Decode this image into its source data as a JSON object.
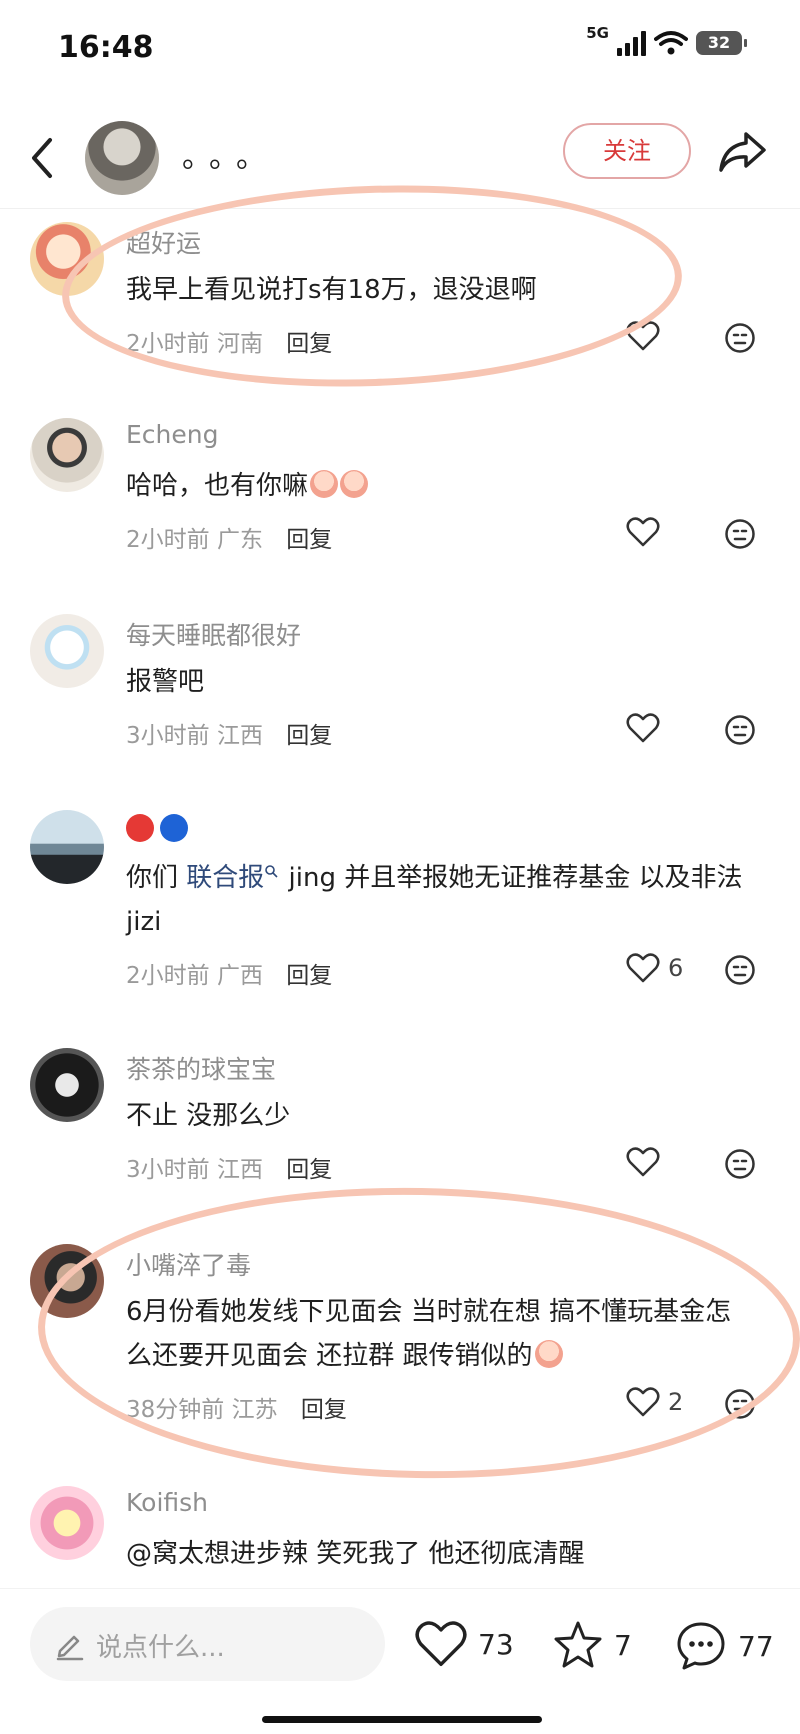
{
  "status_bar": {
    "time": "16:48",
    "network": "5G",
    "battery": "32"
  },
  "header": {
    "author_name": "。。。",
    "follow_label": "关注"
  },
  "comments": [
    {
      "name": "超好运",
      "text": "我早上看见说打s有18万，退没退啊",
      "time": "2小时前",
      "location": "河南",
      "reply": "回复",
      "likes": ""
    },
    {
      "name": "Echeng",
      "text": "哈哈，也有你嘛",
      "time": "2小时前",
      "location": "广东",
      "reply": "回复",
      "likes": ""
    },
    {
      "name": "每天睡眠都很好",
      "text": "报警吧",
      "time": "3小时前",
      "location": "江西",
      "reply": "回复",
      "likes": ""
    },
    {
      "name": "",
      "text_prefix": "你们 ",
      "text_link": "联合报",
      "text_rest": " jing 并且举报她无证推荐基金 以及非法jizi",
      "time": "2小时前",
      "location": "广西",
      "reply": "回复",
      "likes": "6"
    },
    {
      "name": "茶茶的球宝宝",
      "text": "不止 没那么少",
      "time": "3小时前",
      "location": "江西",
      "reply": "回复",
      "likes": ""
    },
    {
      "name": "小嘴淬了毒",
      "text": "6月份看她发线下见面会 当时就在想 搞不懂玩基金怎么还要开见面会 还拉群 跟传销似的",
      "time": "38分钟前",
      "location": "江苏",
      "reply": "回复",
      "likes": "2"
    },
    {
      "name": "Koifish",
      "text": "@窝太想进步辣  笑死我了 他还彻底清醒",
      "time": "",
      "location": "",
      "reply": "",
      "likes": ""
    }
  ],
  "bottom_bar": {
    "placeholder": "说点什么...",
    "likes": "73",
    "stars": "7",
    "comments": "77"
  },
  "colors": {
    "follow_red": "#d83a3a",
    "highlight_oval": "#f7c5b3",
    "link_blue": "#2f4a7a",
    "dot_red": "#e53935",
    "dot_blue": "#1e63d6"
  },
  "icons": [
    "back-arrow-icon",
    "share-icon",
    "heart-icon",
    "dislike-face-icon",
    "pencil-icon",
    "star-icon",
    "chat-bubble-icon",
    "signal-icon",
    "wifi-icon",
    "battery-icon"
  ]
}
